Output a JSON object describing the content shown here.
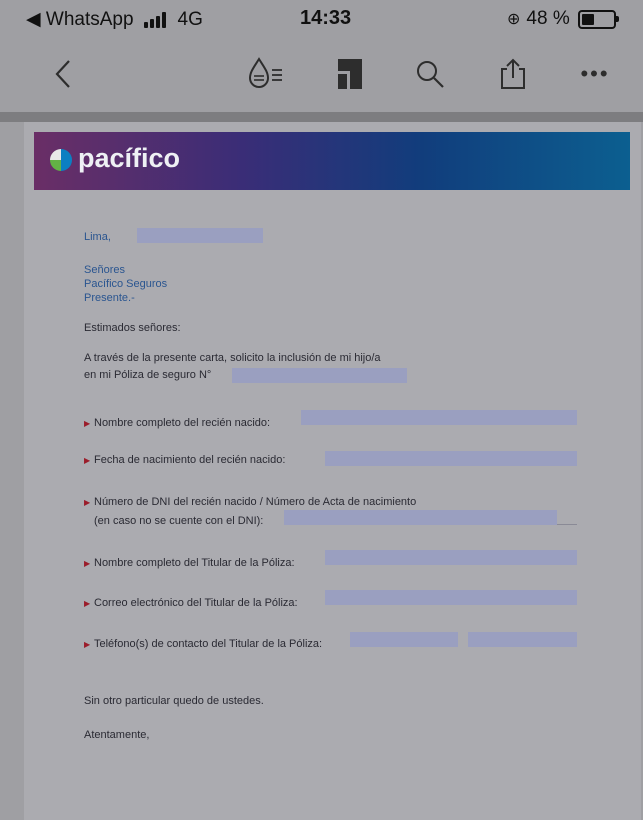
{
  "status_bar": {
    "back_app": "◀ WhatsApp",
    "network": "4G",
    "time": "14:33",
    "battery_percent": "48 %",
    "battery_level": 0.48
  },
  "toolbar": {
    "icons": [
      "back-icon",
      "ink-drop-icon",
      "document-icon",
      "search-icon",
      "share-icon",
      "more-icon"
    ]
  },
  "document": {
    "brand": "pacífico",
    "city_label": "Lima,",
    "recipient": [
      "Señores",
      "Pacífico Seguros",
      "Presente.-"
    ],
    "greeting": "Estimados señores:",
    "body_lines": [
      "A través de la presente carta, solicito la inclusión de mi hijo/a",
      "en mi Póliza de seguro N°"
    ],
    "fields": {
      "newborn_name": "Nombre completo del recién nacido:",
      "newborn_birthdate": "Fecha de nacimiento del recién nacido:",
      "dni_line1": "Número de DNI del recién nacido / Número de Acta de nacimiento",
      "dni_line2": "(en caso no se cuente con el DNI):",
      "holder_name": "Nombre completo del Titular de la Póliza:",
      "holder_email": "Correo electrónico del Titular de la Póliza:",
      "holder_phone": "Teléfono(s) de contacto del Titular de la Póliza:"
    },
    "closing": "Sin otro particular quedo de ustedes.",
    "signoff": "Atentamente,"
  },
  "colors": {
    "banner_start": "#6a2e66",
    "banner_end": "#0c5f90",
    "field_fill": "#9a9fc0",
    "bullet": "#9b1c2a"
  }
}
